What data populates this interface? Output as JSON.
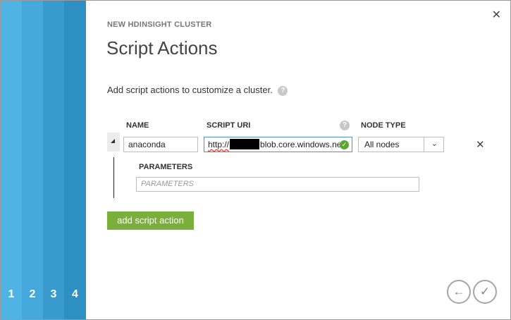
{
  "wizard": {
    "steps": [
      {
        "label": "1",
        "color": "#4fb4e3"
      },
      {
        "label": "2",
        "color": "#44a8da"
      },
      {
        "label": "3",
        "color": "#399bcd"
      },
      {
        "label": "4",
        "color": "#2e8fc2"
      }
    ]
  },
  "header": {
    "close_glyph": "✕",
    "subtitle": "NEW HDINSIGHT CLUSTER",
    "title": "Script Actions"
  },
  "description": {
    "text": "Add script actions to customize a cluster.",
    "help_glyph": "?"
  },
  "table": {
    "columns": {
      "name": "NAME",
      "script_uri": "SCRIPT URI",
      "uri_help_glyph": "?",
      "node_type": "NODE TYPE"
    },
    "row": {
      "name_value": "anaconda",
      "uri_prefix": "http://",
      "uri_suffix": "blob.core.windows.ne",
      "valid_glyph": "✓",
      "node_type_value": "All nodes",
      "node_type_glyph": "⌄",
      "remove_glyph": "✕",
      "parameters_label": "PARAMETERS",
      "parameters_placeholder": "PARAMETERS"
    }
  },
  "actions": {
    "add_label": "add script action",
    "back_glyph": "←",
    "finish_glyph": "✓"
  },
  "colors": {
    "accent_green": "#7aaf3c",
    "valid_green": "#5ca630",
    "focus_blue": "#4f8fd6"
  }
}
